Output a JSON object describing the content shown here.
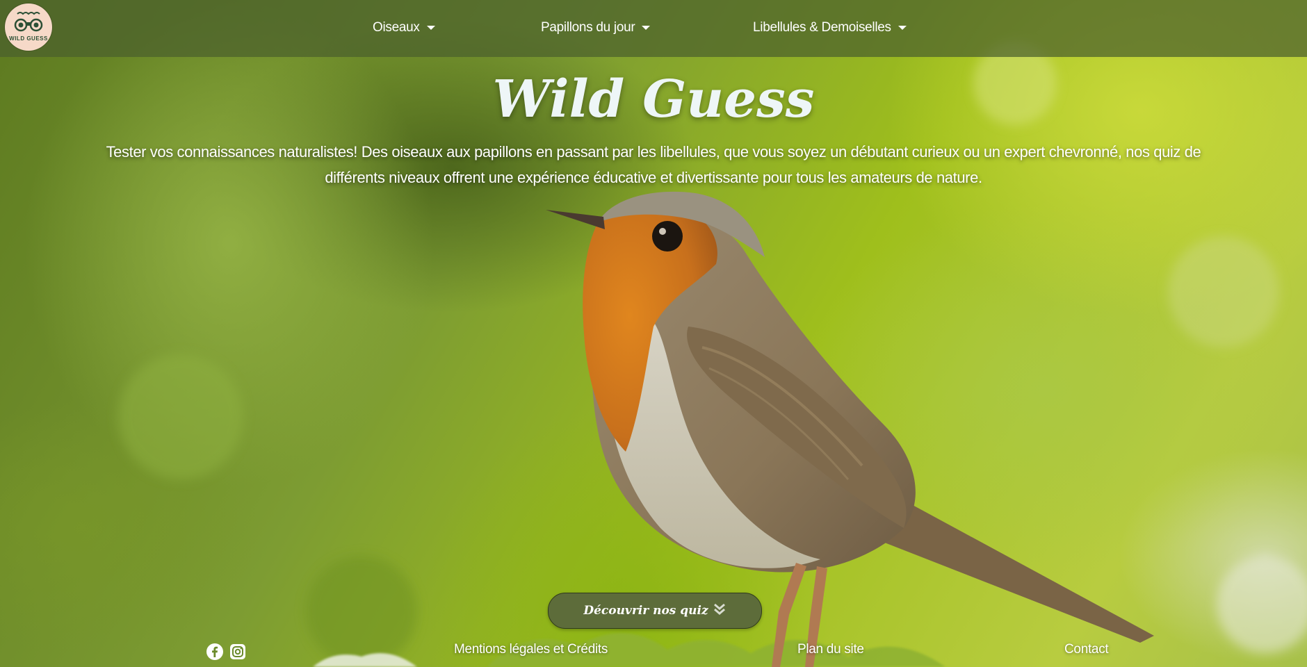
{
  "brand": {
    "logo_text": "WILD GUESS"
  },
  "nav": {
    "items": [
      {
        "label": "Oiseaux"
      },
      {
        "label": "Papillons du jour"
      },
      {
        "label": "Libellules & Demoiselles"
      }
    ]
  },
  "hero": {
    "title": "Wild Guess",
    "description": "Tester vos connaissances naturalistes! Des oiseaux aux papillons en passant par les libellules, que vous soyez un débutant curieux ou un expert chevronné, nos quiz de différents niveaux offrent une expérience éducative et divertissante pour tous les amateurs de nature.",
    "cta_label": "Découvrir nos quiz"
  },
  "footer": {
    "social": [
      {
        "icon": "facebook-icon"
      },
      {
        "icon": "instagram-icon"
      }
    ],
    "links": [
      {
        "label": "Mentions légales et Crédits"
      },
      {
        "label": "Plan du site"
      },
      {
        "label": "Contact"
      }
    ]
  },
  "colors": {
    "navbar": "#4b5f2d",
    "cta_background": "#5d6c3a",
    "logo_background": "#f6d9c8",
    "text": "#ffffff"
  }
}
